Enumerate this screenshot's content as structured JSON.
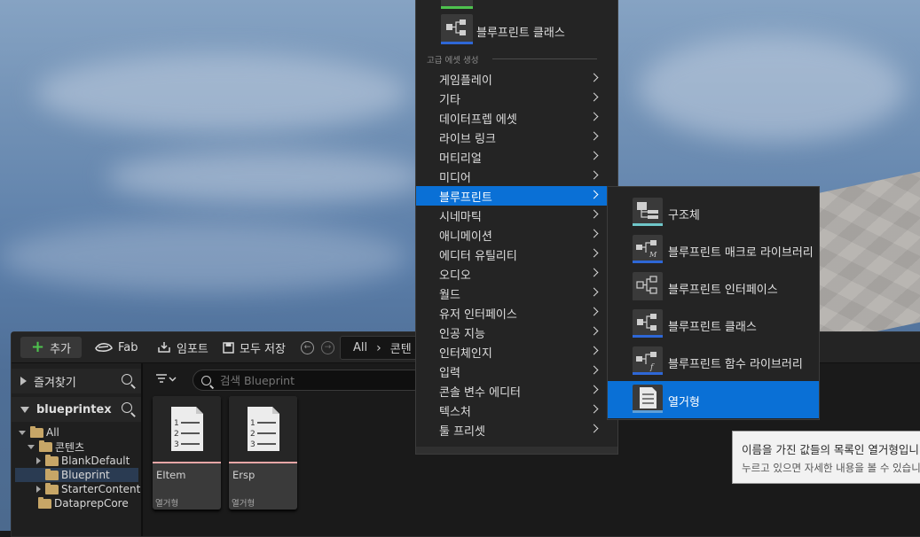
{
  "colors": {
    "highlight": "#0a70d6",
    "blueprint_bar": "#2e67d6",
    "struct_bar": "#6fc6c9",
    "enum_bar": "#5e9fd8",
    "asset_underline": "#e7a6a6",
    "add_green": "#4ec24e"
  },
  "toolbar": {
    "add_label": "추가",
    "fab_label": "Fab",
    "import_label": "임포트",
    "save_all_label": "모두 저장",
    "path": [
      "All",
      "콘텐"
    ]
  },
  "sidebar": {
    "favorites_label": "즐겨찾기",
    "project_label": "blueprintex",
    "tree": [
      {
        "label": "All"
      },
      {
        "label": "콘텐츠"
      },
      {
        "label": "BlankDefault"
      },
      {
        "label": "Blueprint"
      },
      {
        "label": "StarterContent"
      },
      {
        "label": "DataprepCore"
      }
    ]
  },
  "search": {
    "placeholder": "검색 Blueprint"
  },
  "assets": [
    {
      "name": "EItem",
      "type": "열거형"
    },
    {
      "name": "Ersp",
      "type": "열거형"
    }
  ],
  "menu": {
    "blueprint_class_label": "블루프린트 클래스",
    "section_label": "고급 에셋 생성",
    "items": [
      {
        "label": "게임플레이"
      },
      {
        "label": "기타"
      },
      {
        "label": "데이터프렙 에셋"
      },
      {
        "label": "라이브 링크"
      },
      {
        "label": "머티리얼"
      },
      {
        "label": "미디어"
      },
      {
        "label": "블루프린트"
      },
      {
        "label": "시네마틱"
      },
      {
        "label": "애니메이션"
      },
      {
        "label": "에디터 유틸리티"
      },
      {
        "label": "오디오"
      },
      {
        "label": "월드"
      },
      {
        "label": "유저 인터페이스"
      },
      {
        "label": "인공 지능"
      },
      {
        "label": "인터체인지"
      },
      {
        "label": "입력"
      },
      {
        "label": "콘솔 변수 에디터"
      },
      {
        "label": "텍스처"
      },
      {
        "label": "툴 프리셋"
      }
    ]
  },
  "submenu": {
    "items": [
      {
        "label": "구조체",
        "icon": "struct-icon"
      },
      {
        "label": "블루프린트 매크로 라이브러리",
        "icon": "macro-library-icon"
      },
      {
        "label": "블루프린트 인터페이스",
        "icon": "interface-icon"
      },
      {
        "label": "블루프린트 클래스",
        "icon": "blueprint-class-icon"
      },
      {
        "label": "블루프린트 함수 라이브러리",
        "icon": "function-library-icon"
      },
      {
        "label": "열거형",
        "icon": "enum-icon"
      }
    ]
  },
  "tooltip": {
    "line1": "이름을 가진 값들의 목록인 열거형입니다.",
    "line2": "누르고 있으면 자세한 내용을 볼 수 있습니다."
  }
}
